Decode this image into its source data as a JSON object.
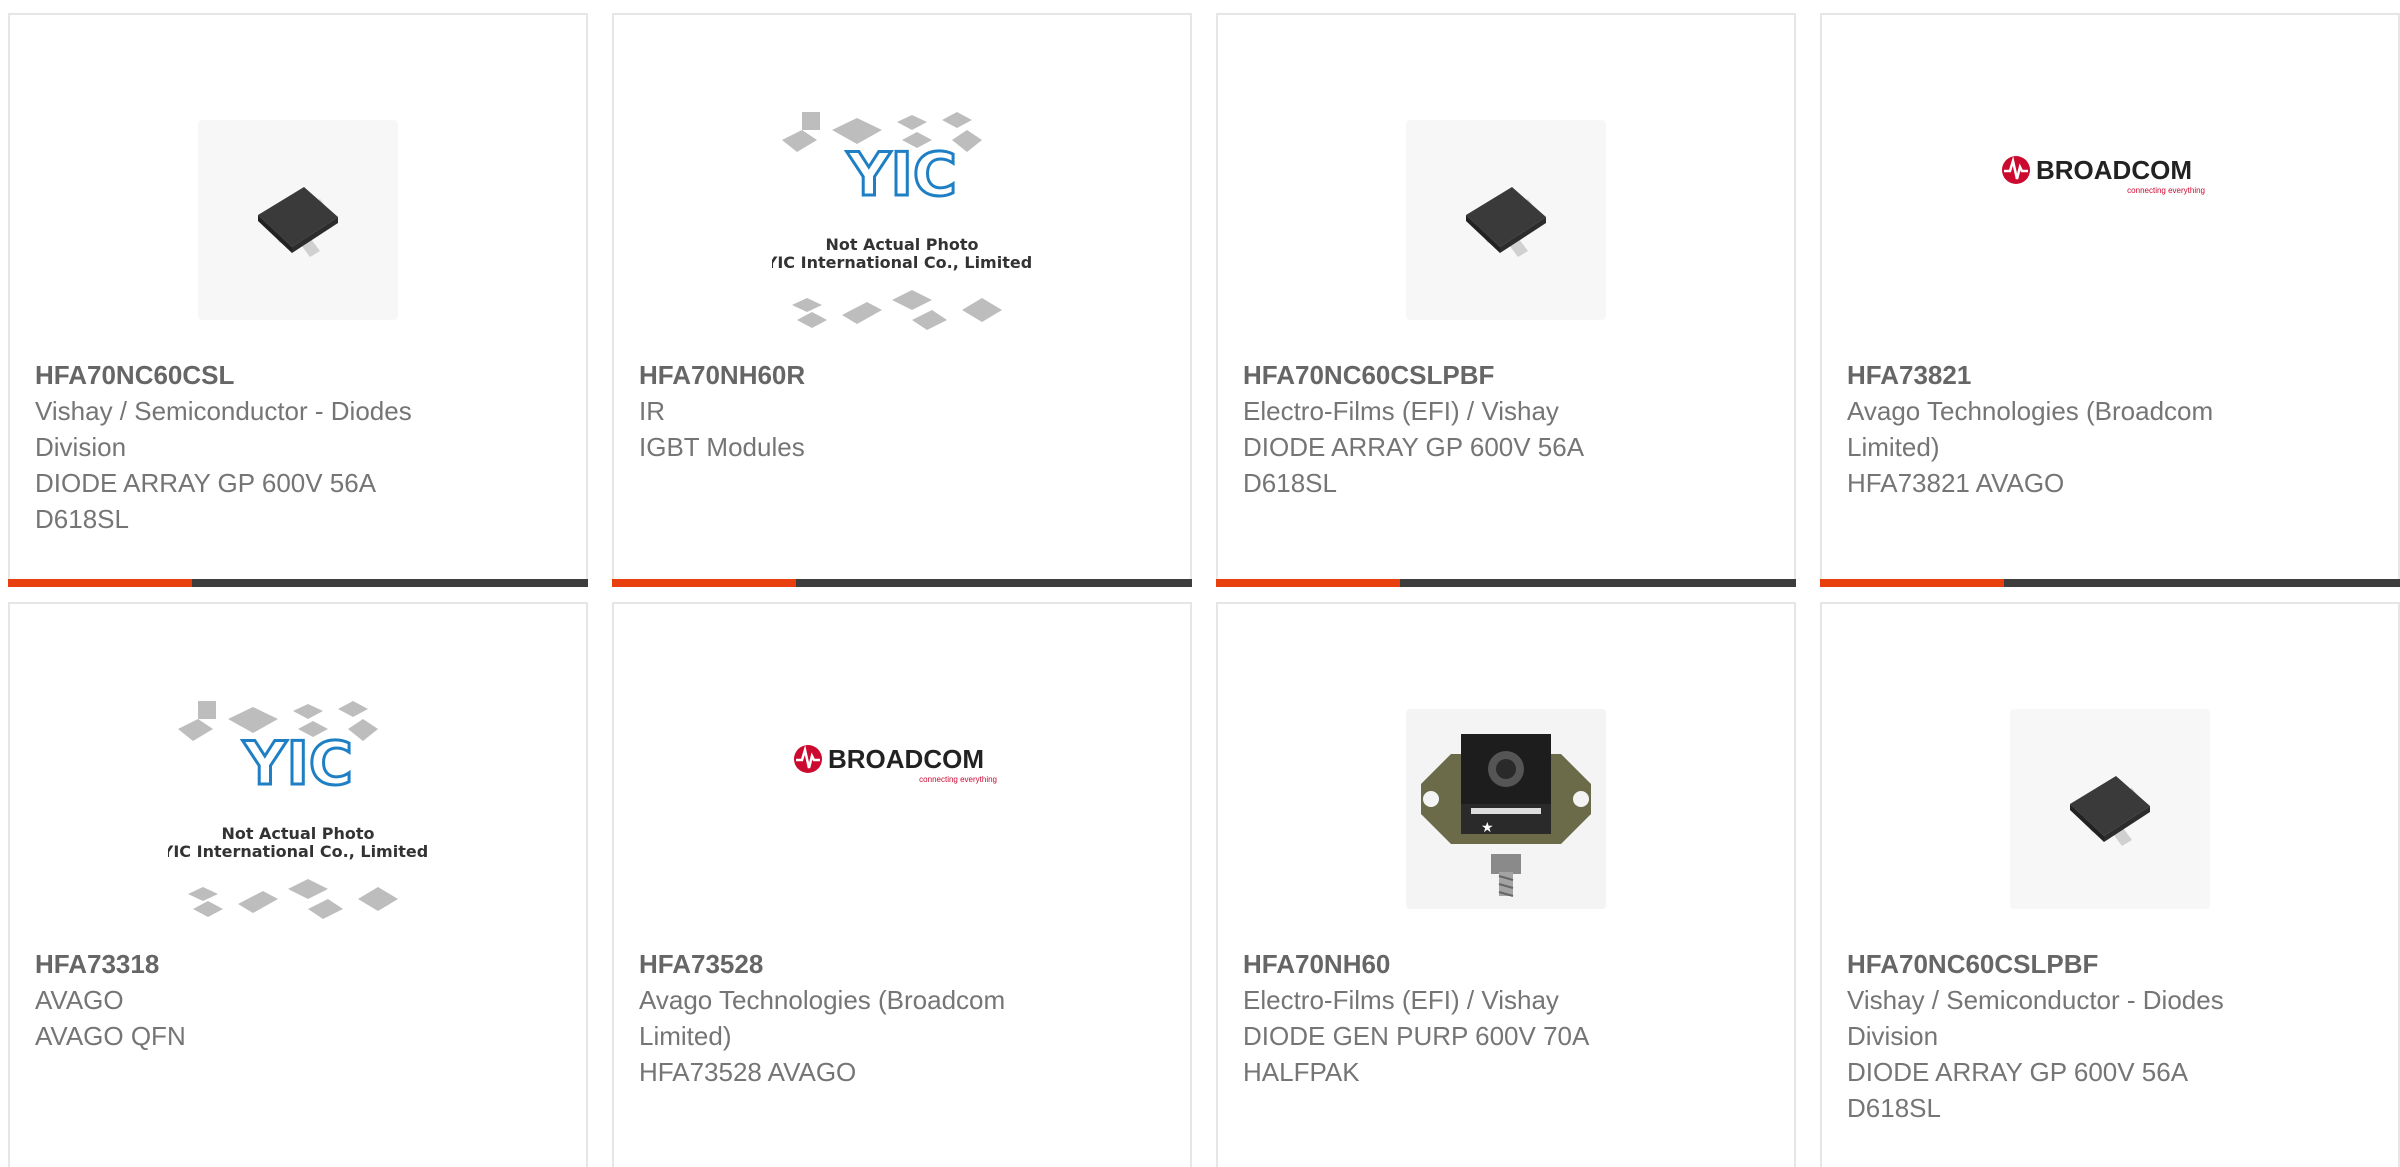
{
  "products": [
    {
      "part_number": "HFA70NC60CSL",
      "lines": [
        "Vishay / Semiconductor - Diodes",
        "Division",
        "DIODE ARRAY GP 600V 56A",
        "D618SL"
      ],
      "image": "chip-sot-icon"
    },
    {
      "part_number": "HFA70NH60R",
      "lines": [
        "IR",
        "IGBT Modules"
      ],
      "image": "yic-placeholder",
      "placeholder_text": [
        "Not Actual Photo",
        "YIC International Co., Limited."
      ],
      "logo_text": "YIC"
    },
    {
      "part_number": "HFA70NC60CSLPBF",
      "lines": [
        "Electro-Films (EFI) / Vishay",
        "DIODE ARRAY GP 600V 56A",
        "D618SL"
      ],
      "image": "chip-sot-icon"
    },
    {
      "part_number": "HFA73821",
      "lines": [
        "Avago Technologies (Broadcom",
        "Limited)",
        "HFA73821 AVAGO"
      ],
      "image": "broadcom-logo",
      "logo_text": "BROADCOM",
      "logo_tagline": "connecting everything"
    },
    {
      "part_number": "HFA73318",
      "lines": [
        "AVAGO",
        "AVAGO QFN"
      ],
      "image": "yic-placeholder",
      "placeholder_text": [
        "Not Actual Photo",
        "YIC International Co., Limited."
      ],
      "logo_text": "YIC"
    },
    {
      "part_number": "HFA73528",
      "lines": [
        "Avago Technologies (Broadcom",
        "Limited)",
        "HFA73528 AVAGO"
      ],
      "image": "broadcom-logo",
      "logo_text": "BROADCOM",
      "logo_tagline": "connecting everything"
    },
    {
      "part_number": "HFA70NH60",
      "lines": [
        "Electro-Films (EFI) / Vishay",
        "DIODE GEN PURP 600V 70A",
        "HALFPAK"
      ],
      "image": "halfpak-module-icon"
    },
    {
      "part_number": "HFA70NC60CSLPBF",
      "lines": [
        "Vishay / Semiconductor - Diodes",
        "Division",
        "DIODE ARRAY GP 600V 56A",
        "D618SL"
      ],
      "image": "chip-sot-icon"
    }
  ],
  "colors": {
    "accent": "#e8400c",
    "bar": "#3d3d3d",
    "text": "#757575",
    "part_number": "#666666",
    "broadcom_red": "#cc092f"
  }
}
